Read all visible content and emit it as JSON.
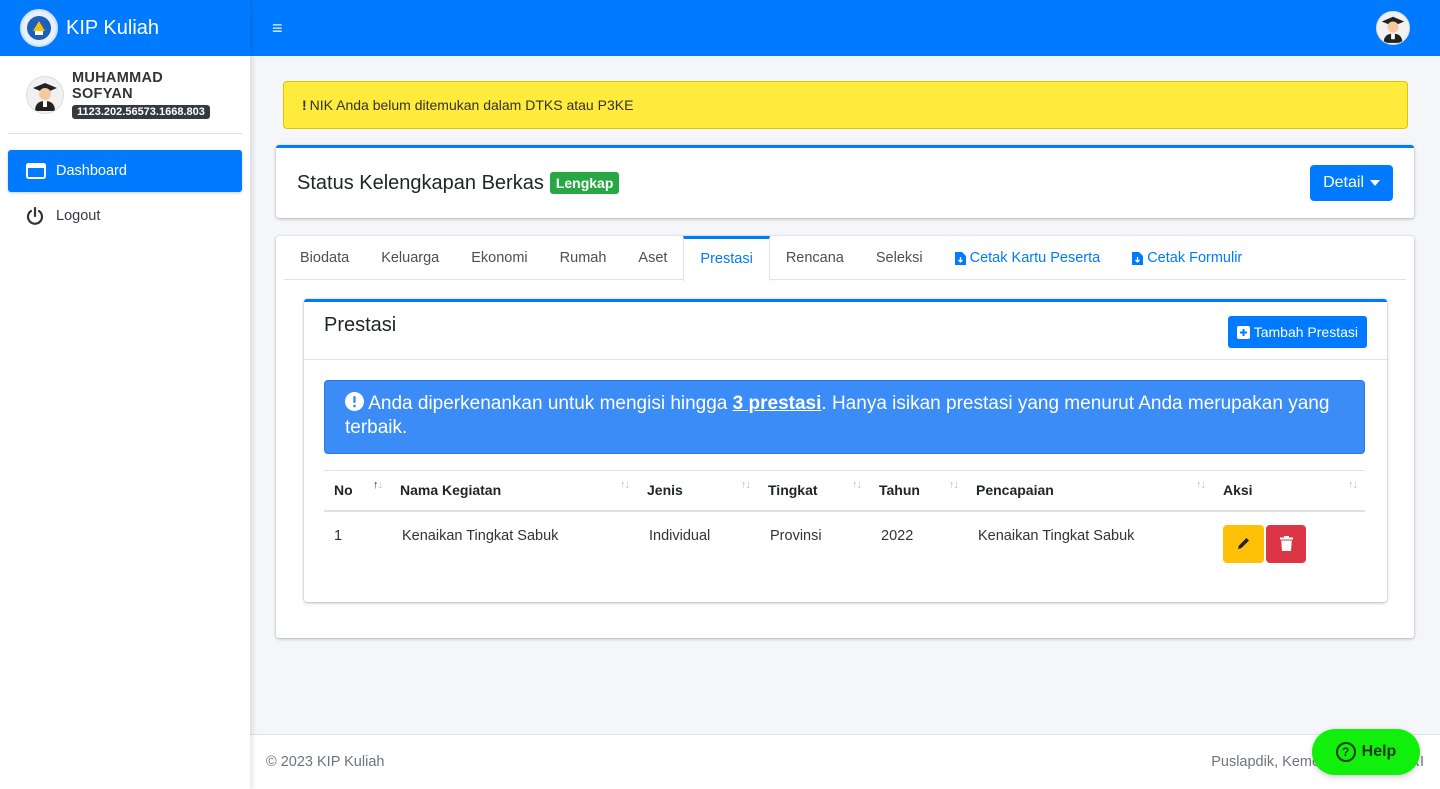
{
  "brand": {
    "title": "KIP Kuliah"
  },
  "user": {
    "name": "MUHAMMAD SOFYAN",
    "nik": "1123.202.56573.1668.803"
  },
  "sidebar": {
    "items": [
      {
        "label": "Dashboard",
        "icon": "window-icon"
      },
      {
        "label": "Logout",
        "icon": "power-icon"
      }
    ]
  },
  "topbar": {
    "menu_icon": "hamburger-icon"
  },
  "alert": {
    "icon": "!",
    "text": "NIK Anda belum ditemukan dalam DTKS atau P3KE"
  },
  "status": {
    "title": "Status Kelengkapan Berkas",
    "badge": "Lengkap",
    "detail_button": "Detail"
  },
  "tabs": [
    {
      "label": "Biodata"
    },
    {
      "label": "Keluarga"
    },
    {
      "label": "Ekonomi"
    },
    {
      "label": "Rumah"
    },
    {
      "label": "Aset"
    },
    {
      "label": "Prestasi"
    },
    {
      "label": "Rencana"
    },
    {
      "label": "Seleksi"
    },
    {
      "label": "Cetak Kartu Peserta"
    },
    {
      "label": "Cetak Formulir"
    }
  ],
  "prestasi": {
    "title": "Prestasi",
    "add_button": "Tambah Prestasi",
    "info_pre": "Anda diperkenankan untuk mengisi hingga ",
    "info_bold": "3 prestasi",
    "info_post": ". Hanya isikan prestasi yang menurut Anda merupakan yang terbaik.",
    "columns": [
      "No",
      "Nama Kegiatan",
      "Jenis",
      "Tingkat",
      "Tahun",
      "Pencapaian",
      "Aksi"
    ],
    "rows": [
      {
        "no": "1",
        "nama": "Kenaikan Tingkat Sabuk",
        "jenis": "Individual",
        "tingkat": "Provinsi",
        "tahun": "2022",
        "pencapaian": "Kenaikan Tingkat Sabuk"
      }
    ]
  },
  "footer": {
    "left": "© 2023 KIP Kuliah",
    "right": "Puslapdik, Kemendikbudristek RI"
  },
  "help": {
    "label": "Help"
  },
  "colors": {
    "primary": "#007bff",
    "warning": "#ffeb3b",
    "success": "#28a745",
    "danger": "#dc3545",
    "edit": "#ffc107",
    "help": "#10f00c"
  }
}
